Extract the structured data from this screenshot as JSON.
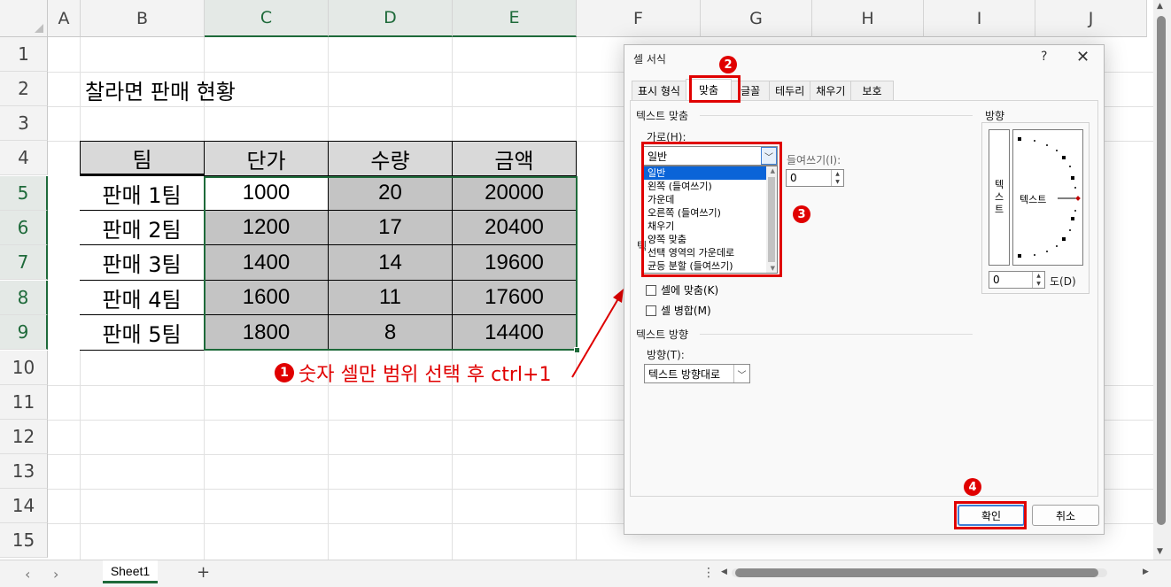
{
  "spreadsheet": {
    "columns": [
      "A",
      "B",
      "C",
      "D",
      "E",
      "F",
      "G",
      "H",
      "I",
      "J"
    ],
    "rows": [
      "1",
      "2",
      "3",
      "4",
      "5",
      "6",
      "7",
      "8",
      "9",
      "10",
      "11",
      "12",
      "13",
      "14",
      "15"
    ],
    "title": "찰라면 판매 현황",
    "table": {
      "headers": [
        "팀",
        "단가",
        "수량",
        "금액"
      ],
      "rows": [
        [
          "판매 1팀",
          "1000",
          "20",
          "20000"
        ],
        [
          "판매 2팀",
          "1200",
          "17",
          "20400"
        ],
        [
          "판매 3팀",
          "1400",
          "14",
          "19600"
        ],
        [
          "판매 4팀",
          "1600",
          "11",
          "17600"
        ],
        [
          "판매 5팀",
          "1800",
          "8",
          "14400"
        ]
      ]
    }
  },
  "annotations": {
    "step1_number": "1",
    "step1_text": "숫자 셀만 범위 선택 후 ctrl+1",
    "step2_number": "2",
    "step3_number": "3",
    "step4_number": "4",
    "color": "#e00000"
  },
  "bottom_bar": {
    "sheet_tab": "Sheet1",
    "add_sheet": "+",
    "prev_arrow": "‹",
    "next_arrow": "›"
  },
  "dialog": {
    "title": "셀 서식",
    "help": "?",
    "close": "✕",
    "tabs": [
      "표시 형식",
      "맞춤",
      "글꼴",
      "테두리",
      "채우기",
      "보호"
    ],
    "active_tab": "맞춤",
    "text_alignment_group": "텍스트 맞춤",
    "horizontal_label": "가로(H):",
    "horizontal_value": "일반",
    "horizontal_options": [
      "일반",
      "왼쪽 (들여쓰기)",
      "가운데",
      "오른쪽 (들여쓰기)",
      "채우기",
      "양쪽 맞춤",
      "선택 영역의 가운데로",
      "균등 분할 (들여쓰기)"
    ],
    "indent_label": "들여쓰기(I):",
    "indent_value": "0",
    "hidden_group_char": "텍",
    "shrink_to_fit": "셀에 맞춤(K)",
    "merge_cells": "셀 병합(M)",
    "text_direction_group": "텍스트 방향",
    "direction_label": "방향(T):",
    "direction_value": "텍스트 방향대로",
    "orientation_group": "방향",
    "vertical_text": [
      "텍",
      "스",
      "트"
    ],
    "dial_text": "텍스트",
    "degrees_value": "0",
    "degrees_label": "도(D)",
    "ok": "확인",
    "cancel": "취소"
  }
}
